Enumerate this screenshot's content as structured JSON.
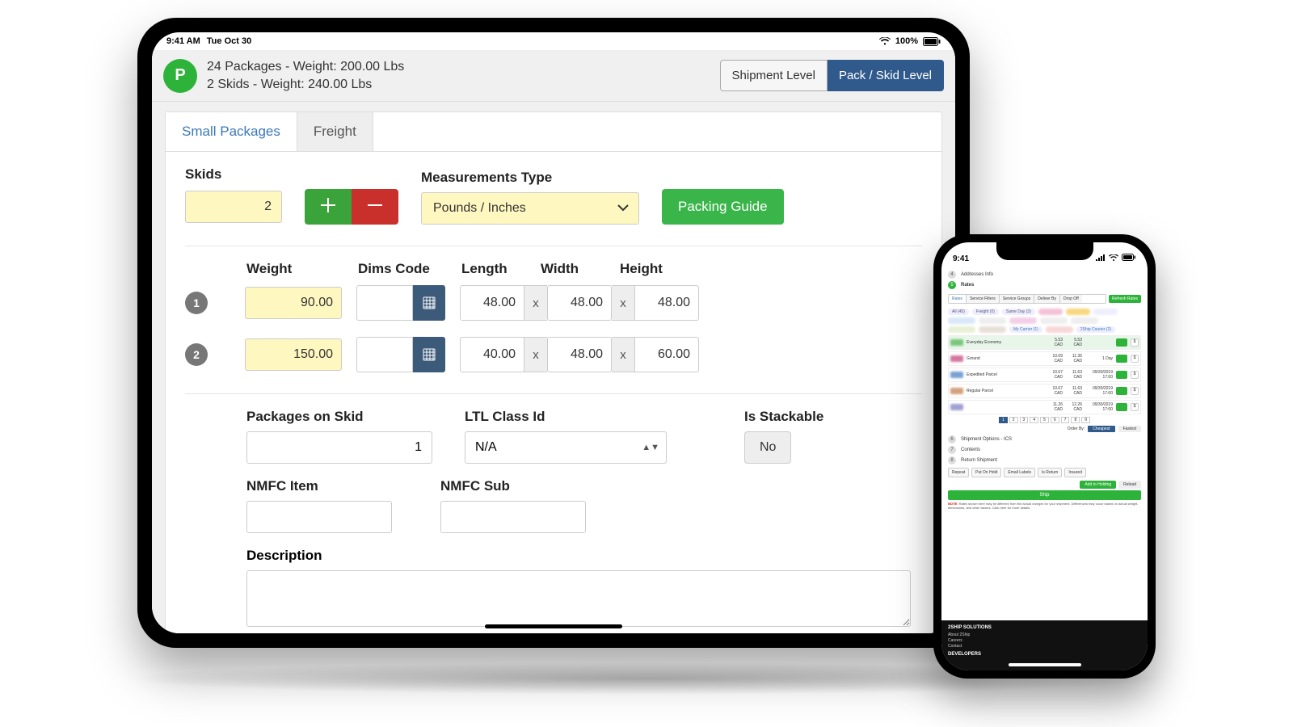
{
  "tablet": {
    "status": {
      "time": "9:41 AM",
      "date": "Tue Oct 30",
      "battery": "100%"
    },
    "header": {
      "avatar_letter": "P",
      "line1": "24 Packages - Weight: 200.00 Lbs",
      "line2": "2 Skids - Weight: 240.00 Lbs",
      "toggle": {
        "shipment": "Shipment Level",
        "pack": "Pack / Skid Level",
        "active": "pack"
      }
    },
    "tabs": {
      "small": "Small Packages",
      "freight": "Freight",
      "active": "small"
    },
    "form": {
      "skids_label": "Skids",
      "skids_value": "2",
      "meas_label": "Measurements Type",
      "meas_value": "Pounds / Inches",
      "packing_guide": "Packing Guide",
      "cols": {
        "weight": "Weight",
        "dims": "Dims Code",
        "length": "Length",
        "width": "Width",
        "height": "Height"
      },
      "rows": [
        {
          "n": "1",
          "weight": "90.00",
          "length": "48.00",
          "width": "48.00",
          "height": "48.00"
        },
        {
          "n": "2",
          "weight": "150.00",
          "length": "40.00",
          "width": "48.00",
          "height": "60.00"
        }
      ],
      "x": "x",
      "lower": {
        "packages_label": "Packages on Skid",
        "packages_value": "1",
        "ltl_label": "LTL Class Id",
        "ltl_value": "N/A",
        "stack_label": "Is Stackable",
        "stack_value": "No",
        "nmfc_item": "NMFC Item",
        "nmfc_sub": "NMFC Sub",
        "desc": "Description"
      }
    }
  },
  "phone": {
    "status_time": "9:41",
    "steps": {
      "addr": "Addresses Info",
      "rates": "Rates"
    },
    "tabs": [
      "Rates",
      "Service Filters",
      "Service Groups",
      "Deliver By",
      "Drop Off"
    ],
    "refresh": "Refresh Rates",
    "filters": [
      "All (45)",
      "Freight (0)",
      "Same Day (3)"
    ],
    "rates": [
      {
        "svc": "Everyday Economy",
        "p1": "5.53 CAD",
        "p2": "5.53 CAD",
        "eta": "",
        "sel": true
      },
      {
        "svc": "Ground",
        "p1": "10.09 CAD",
        "p2": "11.35 CAD",
        "eta": "1 Day",
        "sel": false
      },
      {
        "svc": "Expedited Parcel",
        "p1": "10.67 CAD",
        "p2": "11.63 CAD",
        "eta": "09/30/2019 17:00",
        "sel": false
      },
      {
        "svc": "Regular Parcel",
        "p1": "10.67 CAD",
        "p2": "11.63 CAD",
        "eta": "09/30/2019 17:00",
        "sel": false
      },
      {
        "svc": "",
        "p1": "11.26 CAD",
        "p2": "12.26 CAD",
        "eta": "09/30/2019 17:00",
        "sel": false
      }
    ],
    "pager": [
      "1",
      "2",
      "3",
      "4",
      "5",
      "6",
      "7",
      "8",
      "9"
    ],
    "order_label": "Order By:",
    "order_cheapest": "Cheapest",
    "order_fastest": "Fastest",
    "sections": [
      "Shipment Options - ICS",
      "Contents",
      "Return Shipment"
    ],
    "foot_btns": [
      "Repeat",
      "Put On Hold",
      "Email Labels",
      "Is Return",
      "Insured"
    ],
    "add": "Add to Holding",
    "reload": "Reload",
    "ship": "Ship",
    "note_prefix": "NOTE:",
    "note": " Rates shown here may be different from the actual charges for your shipment. Differences may occur based on actual weight, dimensions, and other factors. Click here for more details.",
    "footer": {
      "title": "2SHIP SOLUTIONS",
      "links": [
        "About 2Ship",
        "Careers",
        "Contact"
      ],
      "dev": "DEVELOPERS"
    }
  }
}
